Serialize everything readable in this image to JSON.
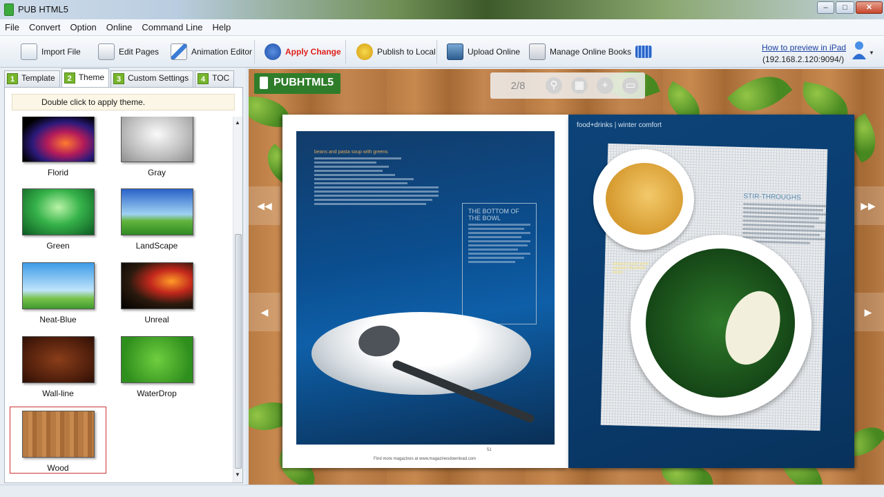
{
  "window": {
    "title": "PUB HTML5",
    "controls": {
      "minimize": "–",
      "maximize": "□",
      "close": "✕"
    }
  },
  "menu": [
    "File",
    "Convert",
    "Option",
    "Online",
    "Command Line",
    "Help"
  ],
  "toolbar": {
    "buttons": [
      {
        "label": "Import File",
        "icon": "import-file-icon"
      },
      {
        "label": "Edit Pages",
        "icon": "edit-pages-icon"
      },
      {
        "label": "Animation Editor",
        "icon": "animation-editor-icon"
      },
      {
        "label": "Apply Change",
        "icon": "apply-change-icon"
      },
      {
        "label": "Publish to Local",
        "icon": "publish-local-icon"
      },
      {
        "label": "Upload Online",
        "icon": "upload-online-icon"
      },
      {
        "label": "Manage Online Books",
        "icon": "manage-books-icon"
      }
    ],
    "ipad_link": "How to preview in iPad",
    "ipad_address": "(192.168.2.120:9094/)"
  },
  "panel": {
    "tabs": [
      {
        "num": "1",
        "label": "Template"
      },
      {
        "num": "2",
        "label": "Theme"
      },
      {
        "num": "3",
        "label": "Custom Settings"
      },
      {
        "num": "4",
        "label": "TOC"
      }
    ],
    "active_tab": "Theme",
    "hint": "Double click to apply theme.",
    "themes": [
      "Florid",
      "Gray",
      "Green",
      "LandScape",
      "Neat-Blue",
      "Unreal",
      "Wall-line",
      "WaterDrop",
      "Wood"
    ],
    "selected_theme": "Wood"
  },
  "preview": {
    "brand": "PUBHTML5",
    "page_indicator": "2/8",
    "left_page": {
      "recipe_title": "beans and pasta soup with greens",
      "box_title": "THE BOTTOM OF THE BOWL",
      "footer": "Find more magazines at www.magazinesdownload.com",
      "page_number": "51"
    },
    "right_page": {
      "header": "food+drinks | winter comfort",
      "sidebar_title": "STIR-THROUGHS",
      "caption": "SPINACH SOUP WITH CREAMY MUSTARD MASH"
    }
  },
  "colors": {
    "accent_red": "#e0201a",
    "tab_green": "#77b52c",
    "brand_green": "#2f7d2a",
    "link_blue": "#1a3fa0"
  }
}
